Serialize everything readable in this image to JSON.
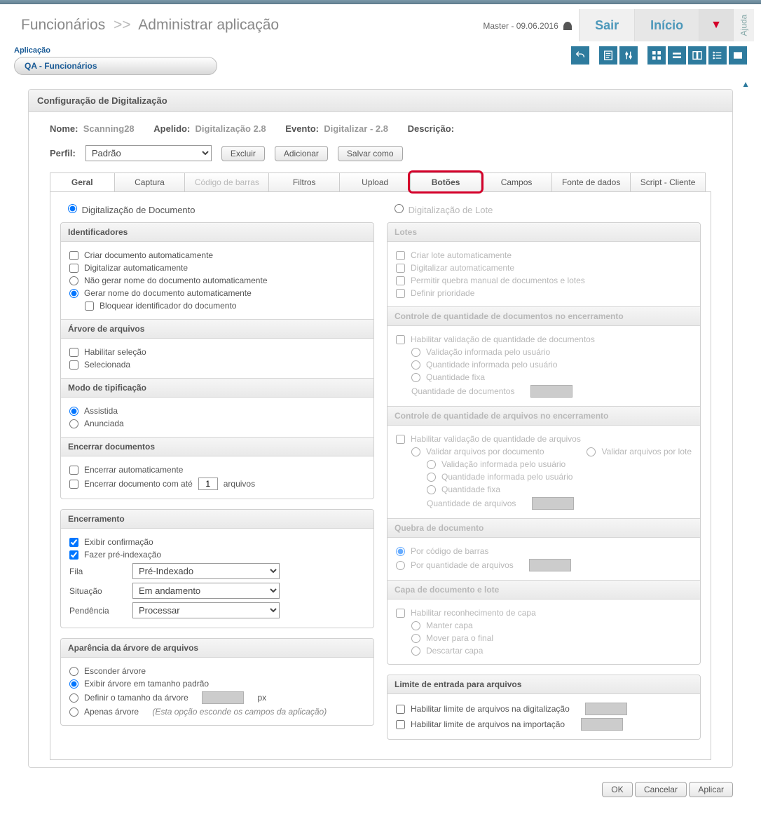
{
  "breadcrumb": {
    "a": "Funcionários",
    "sep": ">>",
    "b": "Administrar aplicação"
  },
  "user": "Master - 09.06.2016",
  "nav": {
    "exit": "Sair",
    "home": "Início",
    "help": "Ajuda"
  },
  "app": {
    "label": "Aplicação",
    "value": "QA - Funcionários"
  },
  "panel_title": "Configuração de Digitalização",
  "info": {
    "name_lbl": "Nome:",
    "name": "Scanning28",
    "alias_lbl": "Apelido:",
    "alias": "Digitalização 2.8",
    "event_lbl": "Evento:",
    "event": "Digitalizar - 2.8",
    "desc_lbl": "Descrição:"
  },
  "profile": {
    "label": "Perfil:",
    "value": "Padrão",
    "btn_delete": "Excluir",
    "btn_add": "Adicionar",
    "btn_saveas": "Salvar como"
  },
  "tabs": [
    "Geral",
    "Captura",
    "Código de barras",
    "Filtros",
    "Upload",
    "Botões",
    "Campos",
    "Fonte de dados",
    "Script - Cliente"
  ],
  "left": {
    "scan_mode_doc": "Digitalização de Documento",
    "identifiers": {
      "title": "Identificadores",
      "auto_create": "Criar documento automaticamente",
      "auto_scan": "Digitalizar automaticamente",
      "no_gen_name": "Não gerar nome do documento automaticamente",
      "gen_name": "Gerar nome do documento automaticamente",
      "lock_id": "Bloquear identificador do documento"
    },
    "tree": {
      "title": "Árvore de arquivos",
      "enable_sel": "Habilitar seleção",
      "selected": "Selecionada"
    },
    "typing": {
      "title": "Modo de tipificação",
      "assisted": "Assistida",
      "announced": "Anunciada"
    },
    "close_docs": {
      "title": "Encerrar documentos",
      "auto_close": "Encerrar automaticamente",
      "close_upto_a": "Encerrar documento com até",
      "close_upto_val": "1",
      "close_upto_b": "arquivos"
    },
    "closing": {
      "title": "Encerramento",
      "confirm": "Exibir confirmação",
      "preindex": "Fazer pré-indexação",
      "queue_lbl": "Fila",
      "queue_val": "Pré-Indexado",
      "status_lbl": "Situação",
      "status_val": "Em andamento",
      "pending_lbl": "Pendência",
      "pending_val": "Processar"
    },
    "appearance": {
      "title": "Aparência da árvore de arquivos",
      "hide": "Esconder árvore",
      "default": "Exibir árvore em tamanho padrão",
      "set_size": "Definir o tamanho da árvore",
      "px": "px",
      "tree_only": "Apenas árvore",
      "tree_only_hint": "(Esta opção esconde os campos da aplicação)"
    }
  },
  "right": {
    "scan_mode_batch": "Digitalização de Lote",
    "batches": {
      "title": "Lotes",
      "auto_create": "Criar lote automaticamente",
      "auto_scan": "Digitalizar automaticamente",
      "manual_break": "Permitir quebra manual de documentos e lotes",
      "priority": "Definir prioridade"
    },
    "doc_qty": {
      "title": "Controle de quantidade de documentos no encerramento",
      "enable": "Habilitar validação de quantidade de documentos",
      "user_valid": "Validação informada pelo usuário",
      "user_qty": "Quantidade informada pelo usuário",
      "fixed": "Quantidade fixa",
      "qty_lbl": "Quantidade de documentos"
    },
    "file_qty": {
      "title": "Controle de quantidade de arquivos no encerramento",
      "enable": "Habilitar validação de quantidade de arquivos",
      "per_doc": "Validar arquivos por documento",
      "per_batch": "Validar arquivos por lote",
      "user_valid": "Validação informada pelo usuário",
      "user_qty": "Quantidade informada pelo usuário",
      "fixed": "Quantidade fixa",
      "qty_lbl": "Quantidade de arquivos"
    },
    "break": {
      "title": "Quebra de documento",
      "barcode": "Por código de barras",
      "qty": "Por quantidade de arquivos"
    },
    "cover": {
      "title": "Capa de documento e lote",
      "enable": "Habilitar reconhecimento de capa",
      "keep": "Manter capa",
      "move": "Mover para o final",
      "discard": "Descartar capa"
    },
    "limit": {
      "title": "Limite de entrada para arquivos",
      "scan": "Habilitar limite de arquivos na digitalização",
      "import": "Habilitar limite de arquivos na importação"
    }
  },
  "footer": {
    "ok": "OK",
    "cancel": "Cancelar",
    "apply": "Aplicar"
  }
}
